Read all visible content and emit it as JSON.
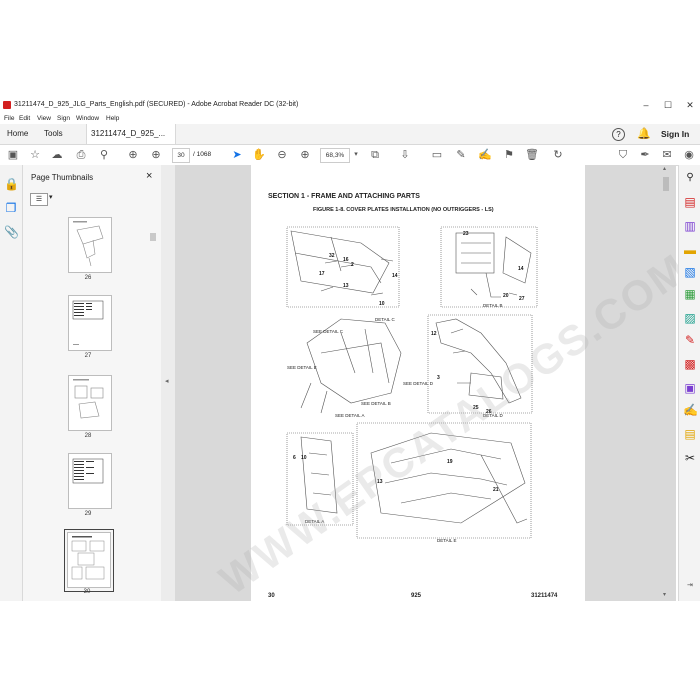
{
  "window": {
    "title": "31211474_D_925_JLG_Parts_English.pdf (SECURED) - Adobe Acrobat Reader DC (32-bit)"
  },
  "menu": [
    "File",
    "Edit",
    "View",
    "Sign",
    "Window",
    "Help"
  ],
  "tabs": {
    "home": "Home",
    "tools": "Tools",
    "doc": "31211474_D_925_...",
    "doc_close": "×",
    "sign_in": "Sign In"
  },
  "toolbar": {
    "page_current": "30",
    "page_total": "/ 1068",
    "zoom": "68,3%"
  },
  "panel": {
    "title": "Page Thumbnails",
    "close": "×",
    "thumbnails": [
      {
        "label": "26"
      },
      {
        "label": "27"
      },
      {
        "label": "28"
      },
      {
        "label": "29"
      },
      {
        "label": "30"
      }
    ]
  },
  "document": {
    "section_title": "SECTION 1 - FRAME AND ATTACHING PARTS",
    "figure_title": "FIGURE 1-8. COVER PLATES INSTALLATION (NO OUTRIGGERS - LS)",
    "watermark": "WWW.EPCATALOGS.COM",
    "footer_left": "30",
    "footer_mid": "925",
    "footer_right": "31211474",
    "detail_labels": [
      "DETAIL C",
      "DETAIL B",
      "DETAIL D",
      "DETAIL A",
      "DETAIL E",
      "SEE DETAIL A",
      "SEE DETAIL B",
      "SEE DETAIL C",
      "SEE DETAIL D",
      "SEE DETAIL E"
    ]
  },
  "colors": {
    "accent": "#1473e6",
    "adobe_red": "#d32020"
  }
}
